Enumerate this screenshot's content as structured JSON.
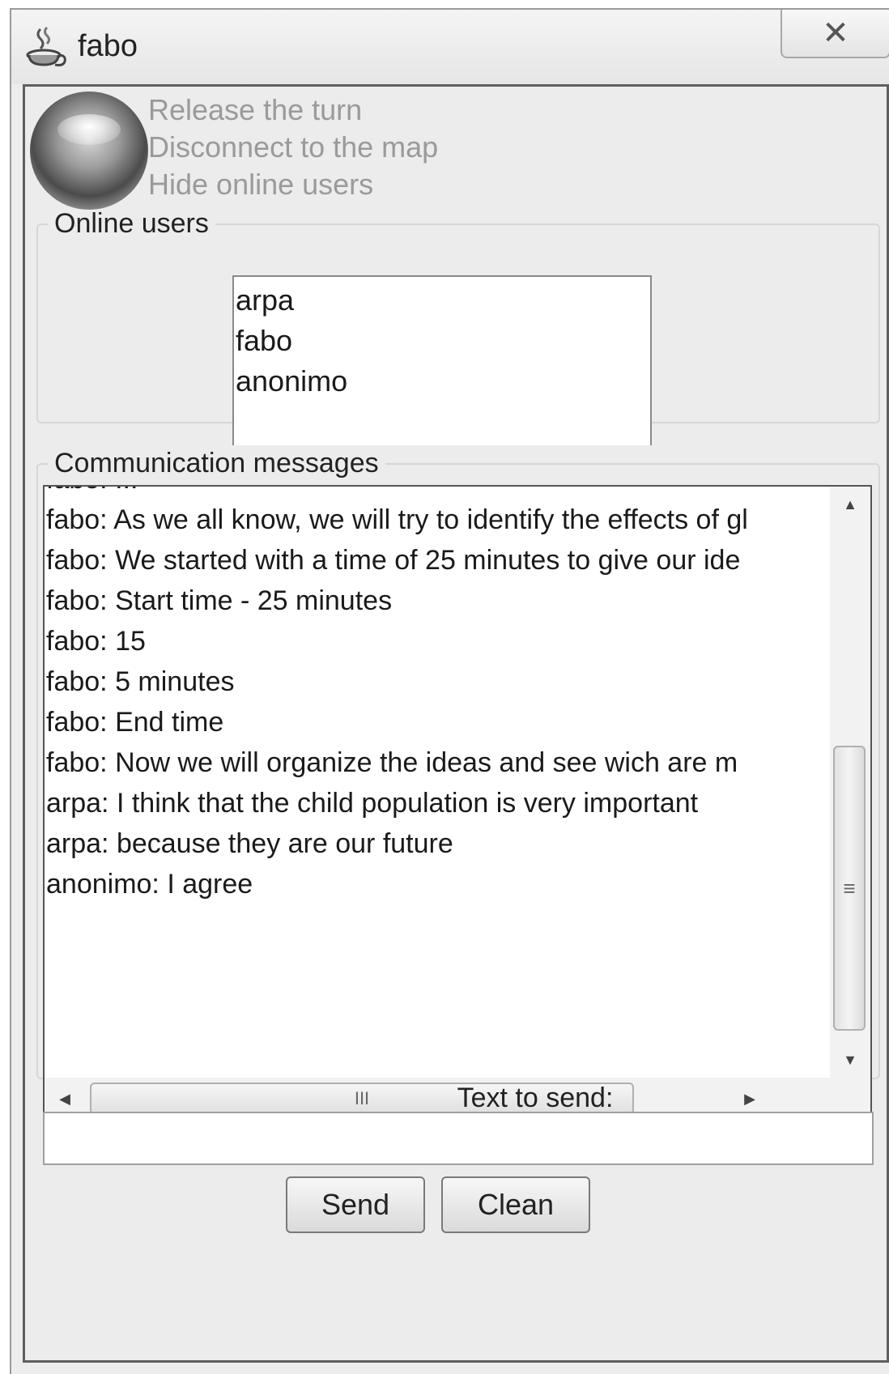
{
  "window": {
    "title": "fabo",
    "close_glyph": "✕"
  },
  "actions": [
    {
      "label": "Release the turn"
    },
    {
      "label": "Disconnect to the map"
    },
    {
      "label": "Hide online users"
    }
  ],
  "online_users": {
    "legend": "Online users",
    "users": [
      "arpa",
      "fabo",
      "anonimo"
    ]
  },
  "messages": {
    "legend": "Communication messages",
    "lines": [
      "fabo: ...",
      "fabo: As we all know, we will try to identify the effects of gl",
      "fabo: We started with a time of 25 minutes to give our ide",
      "fabo: Start time - 25 minutes",
      "fabo: 15",
      "fabo: 5 minutes",
      "fabo: End time",
      "fabo: Now we will organize the ideas and see wich are m",
      "arpa: I think that the child population is very important",
      "arpa: because they are our future",
      "anonimo: I agree"
    ],
    "scroll_up": "▲",
    "scroll_down": "▼",
    "scroll_left": "◀",
    "scroll_right": "▶",
    "vthumb_grip": "≡",
    "hthumb_grip": "III"
  },
  "compose": {
    "label": "Text to send:",
    "value": "",
    "placeholder": ""
  },
  "buttons": {
    "send": "Send",
    "clean": "Clean"
  },
  "icons": {
    "app": "java-coffee-cup-icon",
    "close": "close-icon",
    "status": "status-orb-icon"
  }
}
